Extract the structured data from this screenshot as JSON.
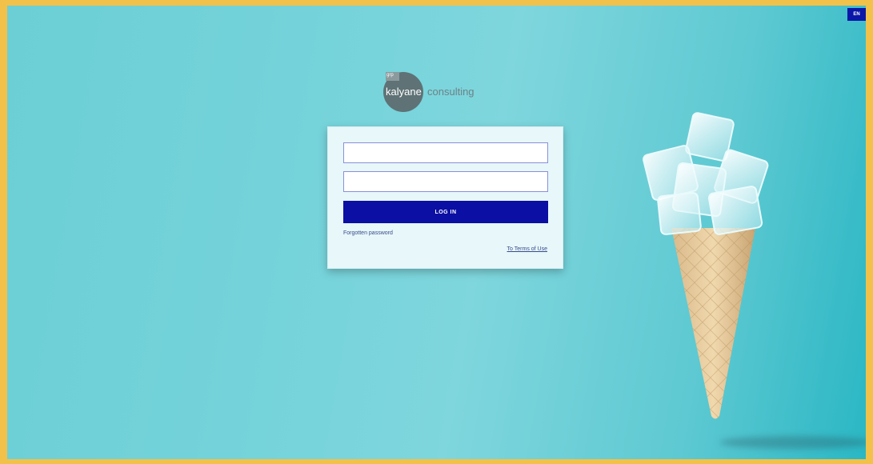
{
  "language": {
    "label": "EN"
  },
  "logo": {
    "tag": "grp",
    "name": "kalyane",
    "suffix": "consulting"
  },
  "login": {
    "username_value": "",
    "password_value": "",
    "button_label": "LOG IN",
    "forgot_label": "Forgotten password",
    "terms_label": "To Terms of Use"
  },
  "colors": {
    "frame_border": "#f2c14a",
    "background_teal": "#6ccfd6",
    "accent_blue": "#0b0fa3"
  }
}
